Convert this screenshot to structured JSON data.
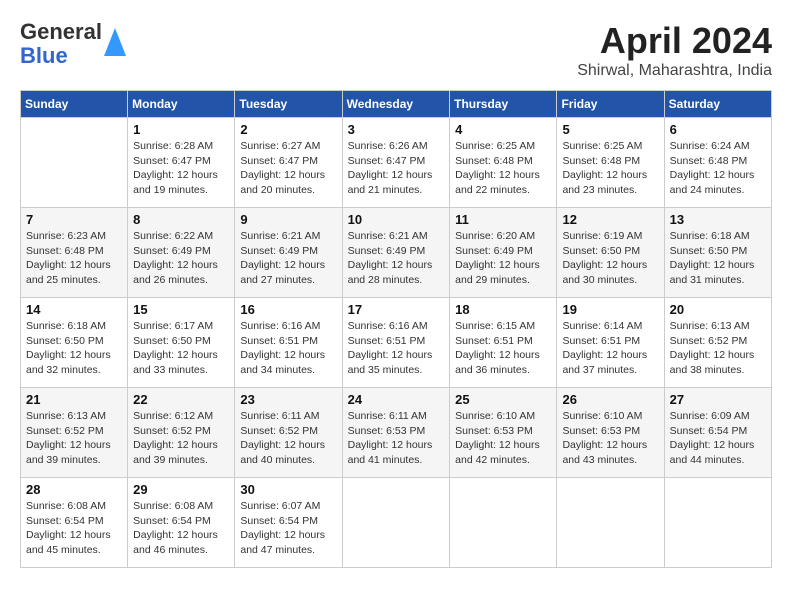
{
  "header": {
    "logo_general": "General",
    "logo_blue": "Blue",
    "title": "April 2024",
    "location": "Shirwal, Maharashtra, India"
  },
  "days_of_week": [
    "Sunday",
    "Monday",
    "Tuesday",
    "Wednesday",
    "Thursday",
    "Friday",
    "Saturday"
  ],
  "weeks": [
    [
      {
        "day": "",
        "info": ""
      },
      {
        "day": "1",
        "info": "Sunrise: 6:28 AM\nSunset: 6:47 PM\nDaylight: 12 hours\nand 19 minutes."
      },
      {
        "day": "2",
        "info": "Sunrise: 6:27 AM\nSunset: 6:47 PM\nDaylight: 12 hours\nand 20 minutes."
      },
      {
        "day": "3",
        "info": "Sunrise: 6:26 AM\nSunset: 6:47 PM\nDaylight: 12 hours\nand 21 minutes."
      },
      {
        "day": "4",
        "info": "Sunrise: 6:25 AM\nSunset: 6:48 PM\nDaylight: 12 hours\nand 22 minutes."
      },
      {
        "day": "5",
        "info": "Sunrise: 6:25 AM\nSunset: 6:48 PM\nDaylight: 12 hours\nand 23 minutes."
      },
      {
        "day": "6",
        "info": "Sunrise: 6:24 AM\nSunset: 6:48 PM\nDaylight: 12 hours\nand 24 minutes."
      }
    ],
    [
      {
        "day": "7",
        "info": "Sunrise: 6:23 AM\nSunset: 6:48 PM\nDaylight: 12 hours\nand 25 minutes."
      },
      {
        "day": "8",
        "info": "Sunrise: 6:22 AM\nSunset: 6:49 PM\nDaylight: 12 hours\nand 26 minutes."
      },
      {
        "day": "9",
        "info": "Sunrise: 6:21 AM\nSunset: 6:49 PM\nDaylight: 12 hours\nand 27 minutes."
      },
      {
        "day": "10",
        "info": "Sunrise: 6:21 AM\nSunset: 6:49 PM\nDaylight: 12 hours\nand 28 minutes."
      },
      {
        "day": "11",
        "info": "Sunrise: 6:20 AM\nSunset: 6:49 PM\nDaylight: 12 hours\nand 29 minutes."
      },
      {
        "day": "12",
        "info": "Sunrise: 6:19 AM\nSunset: 6:50 PM\nDaylight: 12 hours\nand 30 minutes."
      },
      {
        "day": "13",
        "info": "Sunrise: 6:18 AM\nSunset: 6:50 PM\nDaylight: 12 hours\nand 31 minutes."
      }
    ],
    [
      {
        "day": "14",
        "info": "Sunrise: 6:18 AM\nSunset: 6:50 PM\nDaylight: 12 hours\nand 32 minutes."
      },
      {
        "day": "15",
        "info": "Sunrise: 6:17 AM\nSunset: 6:50 PM\nDaylight: 12 hours\nand 33 minutes."
      },
      {
        "day": "16",
        "info": "Sunrise: 6:16 AM\nSunset: 6:51 PM\nDaylight: 12 hours\nand 34 minutes."
      },
      {
        "day": "17",
        "info": "Sunrise: 6:16 AM\nSunset: 6:51 PM\nDaylight: 12 hours\nand 35 minutes."
      },
      {
        "day": "18",
        "info": "Sunrise: 6:15 AM\nSunset: 6:51 PM\nDaylight: 12 hours\nand 36 minutes."
      },
      {
        "day": "19",
        "info": "Sunrise: 6:14 AM\nSunset: 6:51 PM\nDaylight: 12 hours\nand 37 minutes."
      },
      {
        "day": "20",
        "info": "Sunrise: 6:13 AM\nSunset: 6:52 PM\nDaylight: 12 hours\nand 38 minutes."
      }
    ],
    [
      {
        "day": "21",
        "info": "Sunrise: 6:13 AM\nSunset: 6:52 PM\nDaylight: 12 hours\nand 39 minutes."
      },
      {
        "day": "22",
        "info": "Sunrise: 6:12 AM\nSunset: 6:52 PM\nDaylight: 12 hours\nand 39 minutes."
      },
      {
        "day": "23",
        "info": "Sunrise: 6:11 AM\nSunset: 6:52 PM\nDaylight: 12 hours\nand 40 minutes."
      },
      {
        "day": "24",
        "info": "Sunrise: 6:11 AM\nSunset: 6:53 PM\nDaylight: 12 hours\nand 41 minutes."
      },
      {
        "day": "25",
        "info": "Sunrise: 6:10 AM\nSunset: 6:53 PM\nDaylight: 12 hours\nand 42 minutes."
      },
      {
        "day": "26",
        "info": "Sunrise: 6:10 AM\nSunset: 6:53 PM\nDaylight: 12 hours\nand 43 minutes."
      },
      {
        "day": "27",
        "info": "Sunrise: 6:09 AM\nSunset: 6:54 PM\nDaylight: 12 hours\nand 44 minutes."
      }
    ],
    [
      {
        "day": "28",
        "info": "Sunrise: 6:08 AM\nSunset: 6:54 PM\nDaylight: 12 hours\nand 45 minutes."
      },
      {
        "day": "29",
        "info": "Sunrise: 6:08 AM\nSunset: 6:54 PM\nDaylight: 12 hours\nand 46 minutes."
      },
      {
        "day": "30",
        "info": "Sunrise: 6:07 AM\nSunset: 6:54 PM\nDaylight: 12 hours\nand 47 minutes."
      },
      {
        "day": "",
        "info": ""
      },
      {
        "day": "",
        "info": ""
      },
      {
        "day": "",
        "info": ""
      },
      {
        "day": "",
        "info": ""
      }
    ]
  ]
}
